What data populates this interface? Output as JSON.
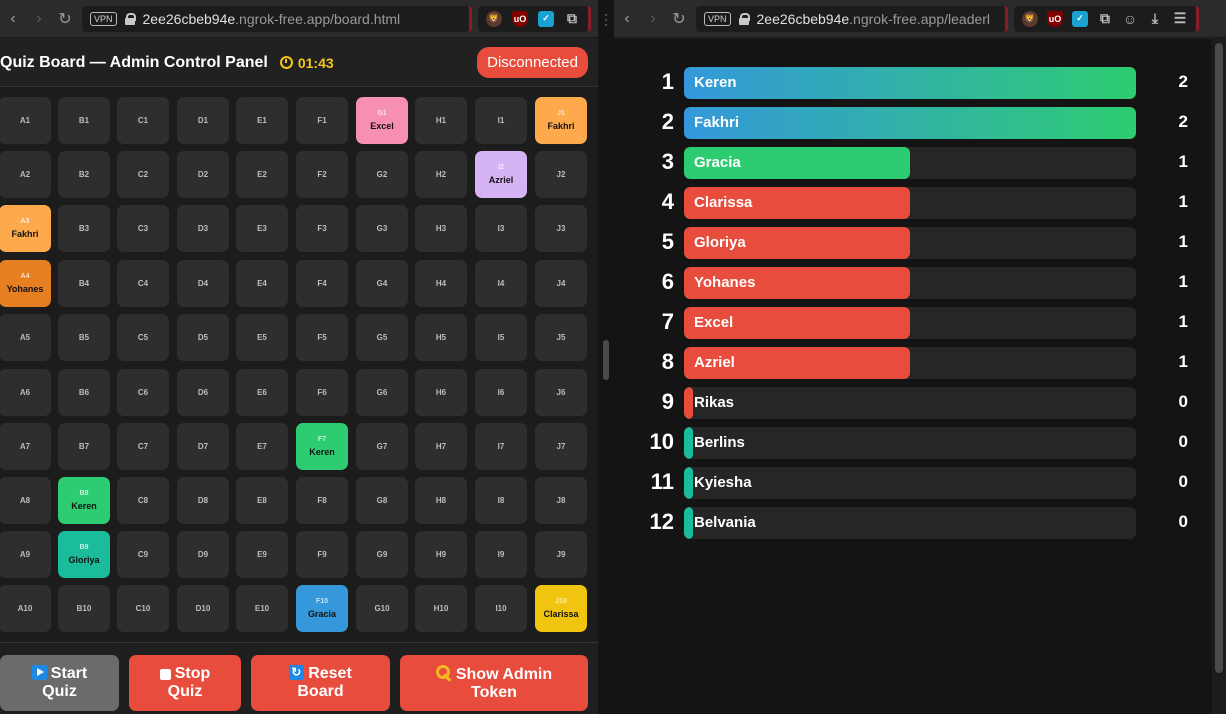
{
  "browser_left": {
    "vpn": "VPN",
    "url_host": "2ee26cbeb94e",
    "url_rest": ".ngrok-free.app/board.html"
  },
  "browser_right": {
    "vpn": "VPN",
    "url_host": "2ee26cbeb94e",
    "url_rest": ".ngrok-free.app/leaderl"
  },
  "board": {
    "title": "Quiz Board — Admin Control Panel",
    "timer": "01:43",
    "connection_status": "Disconnected",
    "columns": [
      "A",
      "B",
      "C",
      "D",
      "E",
      "F",
      "G",
      "H",
      "I",
      "J"
    ],
    "rows": 10,
    "claimed": [
      {
        "cell": "G1",
        "owner": "Excel",
        "color": "#f78fb3"
      },
      {
        "cell": "J1",
        "owner": "Fakhri",
        "color": "#ffa94d"
      },
      {
        "cell": "I2",
        "owner": "Azriel",
        "color": "#d5b3f5"
      },
      {
        "cell": "A3",
        "owner": "Fakhri",
        "color": "#ffa94d"
      },
      {
        "cell": "A4",
        "owner": "Yohanes",
        "color": "#e67e22"
      },
      {
        "cell": "F7",
        "owner": "Keren",
        "color": "#2ecc71"
      },
      {
        "cell": "B8",
        "owner": "Keren",
        "color": "#2ecc71"
      },
      {
        "cell": "B9",
        "owner": "Gloriya",
        "color": "#1abc9c"
      },
      {
        "cell": "F10",
        "owner": "Gracia",
        "color": "#3498db"
      },
      {
        "cell": "J10",
        "owner": "Clarissa",
        "color": "#f1c40f"
      }
    ]
  },
  "controls": {
    "start": {
      "line1": "Start",
      "line2": "Quiz",
      "color": "#6b6b6b"
    },
    "stop": {
      "line1": "Stop",
      "line2": "Quiz",
      "color": "#e74c3c"
    },
    "reset": {
      "line1": "Reset",
      "line2": "Board",
      "color": "#e74c3c"
    },
    "token": {
      "line1": "Show Admin",
      "line2": "Token",
      "color": "#e74c3c"
    }
  },
  "leaderboard": {
    "max_score": 2,
    "entries": [
      {
        "rank": "1",
        "name": "Keren",
        "score": 2,
        "fill": "linear-gradient(90deg,#3498db,#2ecc71)"
      },
      {
        "rank": "2",
        "name": "Fakhri",
        "score": 2,
        "fill": "linear-gradient(90deg,#3498db,#2ecc71)"
      },
      {
        "rank": "3",
        "name": "Gracia",
        "score": 1,
        "fill": "#2ecc71"
      },
      {
        "rank": "4",
        "name": "Clarissa",
        "score": 1,
        "fill": "#e74c3c"
      },
      {
        "rank": "5",
        "name": "Gloriya",
        "score": 1,
        "fill": "#e74c3c"
      },
      {
        "rank": "6",
        "name": "Yohanes",
        "score": 1,
        "fill": "#e74c3c"
      },
      {
        "rank": "7",
        "name": "Excel",
        "score": 1,
        "fill": "#e74c3c"
      },
      {
        "rank": "8",
        "name": "Azriel",
        "score": 1,
        "fill": "#e74c3c"
      },
      {
        "rank": "9",
        "name": "Rikas",
        "score": 0,
        "fill": "#e74c3c"
      },
      {
        "rank": "10",
        "name": "Berlins",
        "score": 0,
        "fill": "#1abc9c"
      },
      {
        "rank": "11",
        "name": "Kyiesha",
        "score": 0,
        "fill": "#1abc9c"
      },
      {
        "rank": "12",
        "name": "Belvania",
        "score": 0,
        "fill": "#1abc9c"
      }
    ]
  }
}
